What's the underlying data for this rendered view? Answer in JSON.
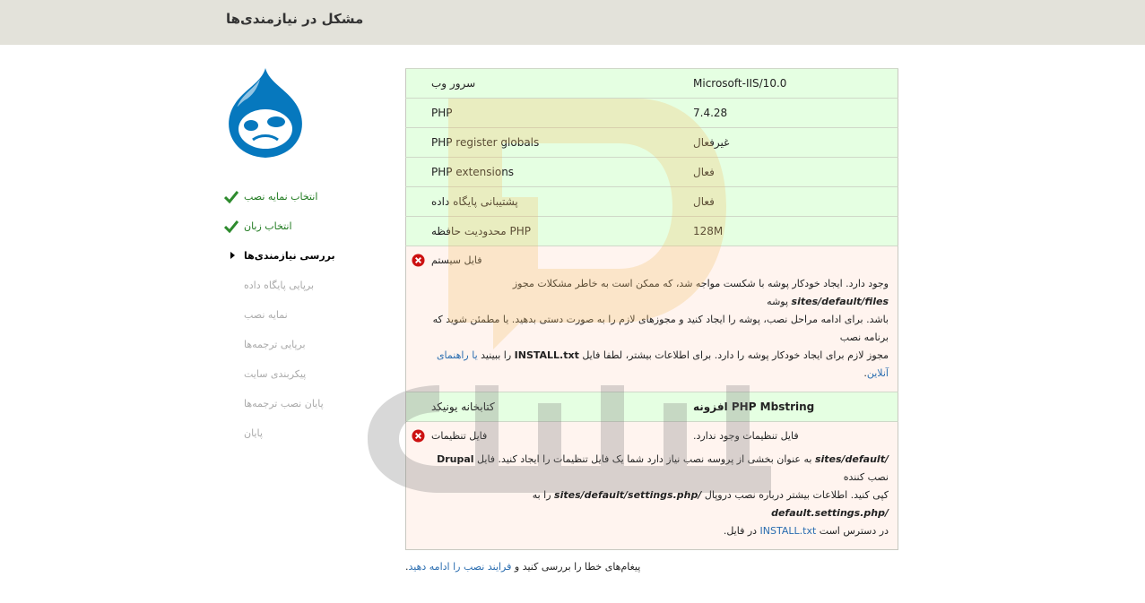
{
  "header": {
    "title": "مشکل در نیازمندی‌ها"
  },
  "steps": [
    {
      "label": "انتخاب نمایه نصب",
      "state": "done"
    },
    {
      "label": "انتخاب زبان",
      "state": "done"
    },
    {
      "label": "بررسی نیازمندی‌ها",
      "state": "active"
    },
    {
      "label": "برپایی پایگاه داده",
      "state": "pending"
    },
    {
      "label": "نمایه نصب",
      "state": "pending"
    },
    {
      "label": "برپایی ترجمه‌ها",
      "state": "pending"
    },
    {
      "label": "پیکربندی سایت",
      "state": "pending"
    },
    {
      "label": "پایان نصب ترجمه‌ها",
      "state": "pending"
    },
    {
      "label": "پایان",
      "state": "pending"
    }
  ],
  "requirements": [
    {
      "title": "سرور وب",
      "value": "Microsoft-IIS/10.0",
      "status": "ok"
    },
    {
      "title": "PHP",
      "value": "7.4.28",
      "status": "ok"
    },
    {
      "title": "PHP register globals",
      "value": "غیرفعال",
      "status": "ok"
    },
    {
      "title": "PHP extensions",
      "value": "فعال",
      "status": "ok"
    },
    {
      "title": "پشتیبانی پایگاه داده",
      "value": "فعال",
      "status": "ok"
    },
    {
      "title": "PHP محدودیت حافظه",
      "value": "128M",
      "status": "ok"
    }
  ],
  "file_system": {
    "title": "فایل سیستم",
    "line1_a": "وجود دارد. ایجاد خودکار پوشه با شکست مواجه شد، که ممکن است به خاطر مشکلات مجوز",
    "line1_path": "sites/default/files",
    "line1_b": "پوشه",
    "line2": "باشد. برای ادامه مراحل نصب، پوشه را ایجاد کنید و مجوزهای لازم را به صورت دستی بدهید. یا مطمئن شوید که برنامه نصب",
    "line3_a": "مجوز لازم برای ایجاد خودکار پوشه را دارد. برای اطلاعات بیشتر، لطفا فایل",
    "line3_file": "INSTALL.txt",
    "line3_b": "را ببینید",
    "line3_link": "یا راهنمای آنلاین",
    "line3_end": "."
  },
  "mbstring": {
    "title": "کتابخانه یونیکد",
    "value": "PHP Mbstring افزونه"
  },
  "settings_file": {
    "title": "فایل تنظیمات",
    "value": "فایل تنظیمات وجود ندارد.",
    "line1_path": "/sites/default",
    "line1_text": "به عنوان بخشی از پروسه نصب نیاز دارد شما یک فایل تنظیمات را ایجاد کنید. فایل",
    "line1_file": "Drupal",
    "line1_end": "نصب کننده",
    "line2_a": "کپی کنید. اطلاعات بیشتر درباره نصب دروپال",
    "line2_path1": "/sites/default/settings.php",
    "line2_b": "را به",
    "line2_path2": "/default.settings.php",
    "line3_a": "در دسترس است",
    "line3_link": "INSTALL.txt",
    "line3_b": "در فایل",
    "line3_end": "."
  },
  "footer": {
    "text_a": "پیغام‌های خطا را بررسی کنید و",
    "link": "فرایند نصب را ادامه دهید",
    "text_b": "."
  },
  "colors": {
    "ok_bg": "#e5ffe2",
    "err_bg": "#fff4ef",
    "header_bg": "#e3e2da",
    "link": "#2a6db0",
    "done": "#1f7a1f"
  }
}
